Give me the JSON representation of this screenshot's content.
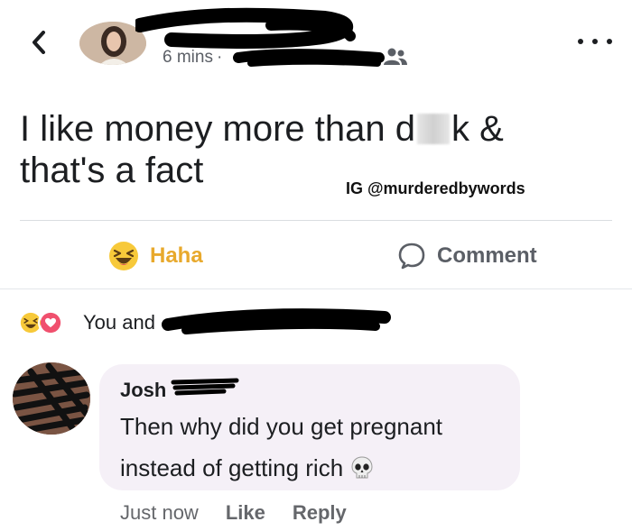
{
  "header": {
    "back_icon": "chevron-left-icon",
    "time": "6 mins",
    "separator": "·",
    "audience_icon": "friends-icon",
    "more_icon": "more-dots-icon"
  },
  "post": {
    "text_line1_before": "I like money more than d",
    "text_line1_after": "k &",
    "text_line2": "that's a fact",
    "watermark": "IG @murderedbywords"
  },
  "actions": {
    "haha_label": "Haha",
    "comment_label": "Comment"
  },
  "reactions": {
    "summary": "You and"
  },
  "comment": {
    "author": "Josh",
    "line1": "Then why did you get pregnant",
    "line2": "instead of getting rich",
    "time": "Just now",
    "like_label": "Like",
    "reply_label": "Reply"
  },
  "colors": {
    "haha": "#e8a92c",
    "love": "#f0506e",
    "bubble": "#f5f0f7",
    "secondary_text": "#65676b"
  }
}
